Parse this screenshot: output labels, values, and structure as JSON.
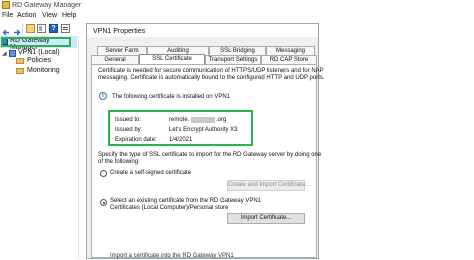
{
  "window": {
    "title": "RD Gateway Manager"
  },
  "menu": [
    "File",
    "Action",
    "View",
    "Help"
  ],
  "tree": {
    "root": "RD Gateway Manager",
    "server": "VPN1 (Local)",
    "children": [
      "Policies",
      "Monitoring"
    ]
  },
  "dialog": {
    "title": "VPN1 Properties",
    "tabs_row1": [
      "Server Farm",
      "Auditing",
      "SSL Bridging",
      "Messaging"
    ],
    "tabs_row2": [
      "General",
      "SSL Certificate",
      "Transport Settings",
      "RD CAP Store"
    ],
    "active_tab": "SSL Certificate",
    "description": [
      "Certificate is needed for secure communication of HTTPS/UDP listeners and for NAP",
      "messaging. Certificate is automatically bound to the configured HTTP and UDP ports."
    ],
    "installed_note": "The following certificate is installed on VPN1",
    "cert": {
      "issued_to_label": "Issued to:",
      "issued_to_value": "remote.",
      "issued_to_suffix": ".org",
      "issued_by_label": "Issued by:",
      "issued_by_value": "Let's Encrypt Authority X3",
      "expiration_label": "Expiration date:",
      "expiration_value": "1/4/2021"
    },
    "type_prompt": [
      "Specify the type of SSL certificate to import for the RD Gateway server by doing one",
      "of the following:"
    ],
    "option1": "Create a self-signed certificate",
    "create_button": "Create and Import Certificate...",
    "option2": [
      "Select an existing certificate from the RD Gateway VPN1",
      "Certificates (Local Computer)/Personal store"
    ],
    "import_button": "Import Certificate...",
    "option3_partial": "Import a certificate into the RD Gateway VPN1"
  },
  "colors": {
    "highlight": "#2db34a",
    "selection": "#cce8ff",
    "dialog_bg": "#f0f0f0"
  }
}
